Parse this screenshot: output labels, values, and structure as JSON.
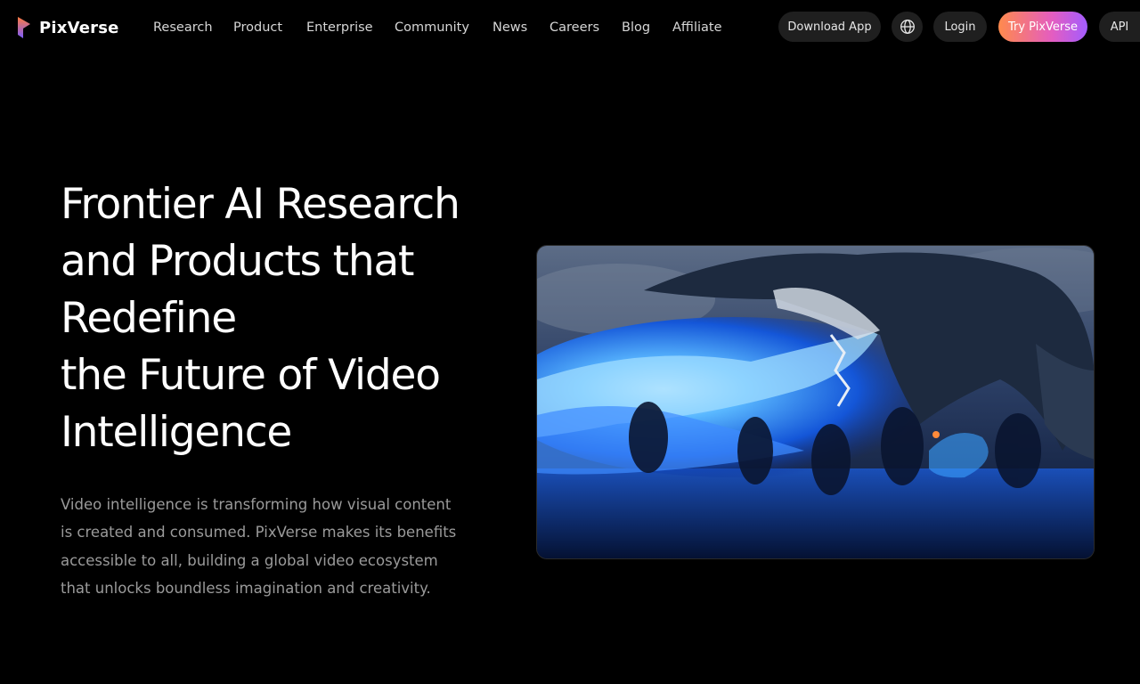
{
  "brand": {
    "name": "PixVerse",
    "logo_icon": "pixverse-logo-icon",
    "colors": {
      "logo_top": "#ff7a3d",
      "logo_bottom": "#7b5cff",
      "cta_gradient_start": "#ff8a4c",
      "cta_gradient_end": "#a35cff"
    }
  },
  "nav": {
    "links": [
      {
        "label": "Research"
      },
      {
        "label": "Product"
      },
      {
        "label": "Enterprise"
      },
      {
        "label": "Community"
      },
      {
        "label": "News"
      },
      {
        "label": "Careers"
      },
      {
        "label": "Blog"
      },
      {
        "label": "Affiliate"
      }
    ],
    "actions": {
      "download_label": "Download App",
      "language_icon": "globe-icon",
      "login_label": "Login",
      "try_label": "Try PixVerse",
      "api_label": "API"
    }
  },
  "hero": {
    "headline_lines": [
      "Frontier AI Research",
      "and Products that",
      "Redefine",
      "the Future of Video",
      "Intelligence"
    ],
    "description": "Video intelligence is transforming how visual content is created and consumed. PixVerse makes its benefits accessible to all, building a global video ecosystem that unlocks boundless imagination and creativity.",
    "media": {
      "subject": "dragon-breathing-blue-fire-over-soldiers"
    }
  }
}
